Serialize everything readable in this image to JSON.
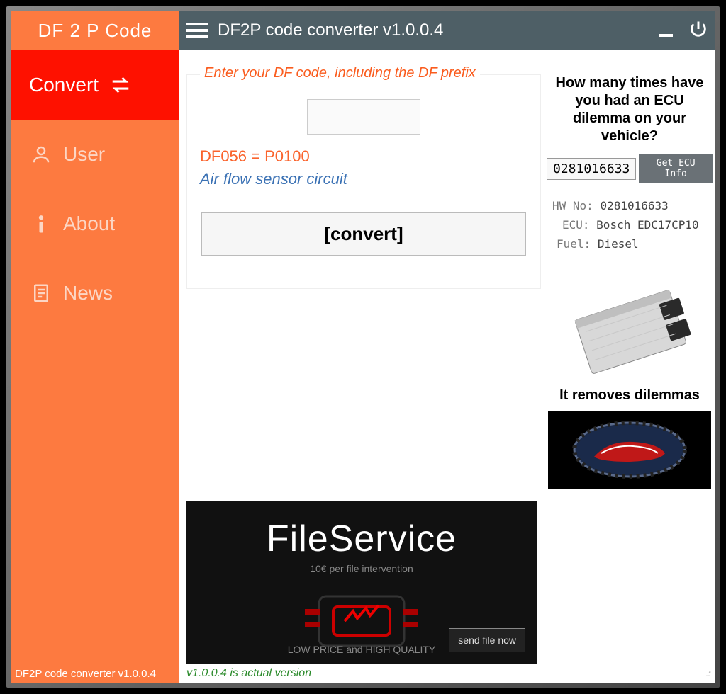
{
  "brand": "DF 2 P Code",
  "app_title": "DF2P code converter v1.0.0.4",
  "sidebar": {
    "items": [
      {
        "label": "Convert",
        "icon": "swap"
      },
      {
        "label": "User",
        "icon": "user"
      },
      {
        "label": "About",
        "icon": "info"
      },
      {
        "label": "News",
        "icon": "doc"
      }
    ]
  },
  "main": {
    "input_legend": "Enter your DF code, including the DF prefix",
    "code_result": "DF056 = P0100",
    "code_desc": "Air flow sensor circuit",
    "convert_label": "[convert]"
  },
  "banner": {
    "title": "FileService",
    "sub1": "10€ per file intervention",
    "sub2": "LOW PRICE and HIGH QUALITY",
    "cta": "send file now"
  },
  "ecu": {
    "question": "How many times have you had an ECU dilemma on your vehicle?",
    "number": "0281016633",
    "btn": "Get ECU Info",
    "hw_lbl": "HW No:",
    "hw": "0281016633",
    "ecu_lbl": "ECU:",
    "ecu": "Bosch EDC17CP10",
    "fuel_lbl": "Fuel:",
    "fuel": "Diesel",
    "tagline": "It removes dilemmas"
  },
  "footer": {
    "left": "DF2P code converter v1.0.0.4",
    "right": "v1.0.0.4 is actual version"
  }
}
